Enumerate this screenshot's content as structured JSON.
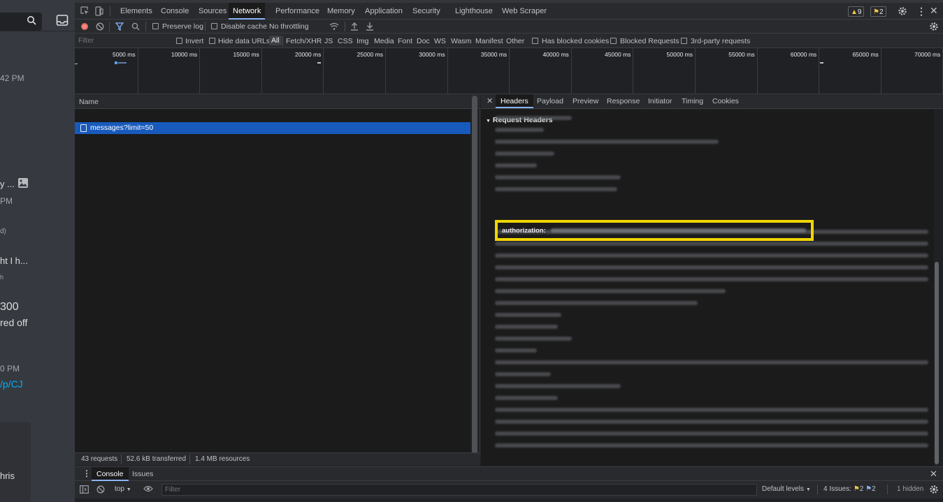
{
  "background_app": {
    "times": [
      "42 PM",
      "PM",
      "0 PM"
    ],
    "snippets": [
      "y ...",
      "d)",
      "ht I h...",
      "h",
      "300",
      "red off",
      "/p/CJ",
      "hris"
    ]
  },
  "devtools": {
    "tabs": [
      "Elements",
      "Console",
      "Sources",
      "Network",
      "Performance",
      "Memory",
      "Application",
      "Security",
      "Lighthouse",
      "Web Scraper"
    ],
    "active_tab": "Network",
    "warnings": "9",
    "issues": "2",
    "toolbar": {
      "preserve_log": "Preserve log",
      "disable_cache": "Disable cache",
      "throttling": "No throttling"
    },
    "filterbar": {
      "placeholder": "Filter",
      "invert": "Invert",
      "hide_data_urls": "Hide data URLs",
      "types": [
        "All",
        "Fetch/XHR",
        "JS",
        "CSS",
        "Img",
        "Media",
        "Font",
        "Doc",
        "WS",
        "Wasm",
        "Manifest",
        "Other"
      ],
      "has_blocked_cookies": "Has blocked cookies",
      "blocked_requests": "Blocked Requests",
      "third_party": "3rd-party requests"
    },
    "timeline_ticks": [
      "5000 ms",
      "10000 ms",
      "15000 ms",
      "20000 ms",
      "25000 ms",
      "30000 ms",
      "35000 ms",
      "40000 ms",
      "45000 ms",
      "50000 ms",
      "55000 ms",
      "60000 ms",
      "65000 ms",
      "70000 ms"
    ],
    "request_list": {
      "column_name": "Name",
      "selected_request": "messages?limit=50"
    },
    "status_bar": {
      "requests": "43 requests",
      "transferred": "52.6 kB transferred",
      "resources": "1.4 MB resources"
    },
    "detail_tabs": [
      "Headers",
      "Payload",
      "Preview",
      "Response",
      "Initiator",
      "Timing",
      "Cookies"
    ],
    "active_detail_tab": "Headers",
    "request_headers_title": "Request Headers",
    "authorization_key": "authorization:",
    "drawer": {
      "tabs": [
        "Console",
        "Issues"
      ],
      "context": "top",
      "filter_placeholder": "Filter",
      "levels": "Default levels",
      "issues_label": "4 Issues:",
      "issues_a": "2",
      "issues_b": "2",
      "hidden": "1 hidden"
    }
  }
}
